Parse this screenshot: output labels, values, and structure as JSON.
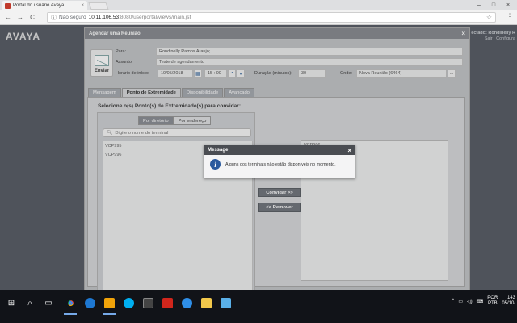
{
  "browser": {
    "tab_title": "Portal do usuário Avaya",
    "tab_close": "×",
    "win_min": "–",
    "win_max": "□",
    "win_close": "×",
    "back": "←",
    "forward": "→",
    "reload": "C",
    "security_label": "Não seguro",
    "url_host": "10.11.106.53",
    "url_rest": ":8080/userportal/views/main.jsf",
    "star": "☆",
    "menu": "⋮"
  },
  "portal": {
    "brand": "AVAYA",
    "user_name": "ectado: Rondinelly R",
    "links": [
      "Sair",
      "Configura"
    ]
  },
  "dialog": {
    "title": "Agendar uma Reunião",
    "close": "×",
    "send_label": "Enviar",
    "para_label": "Para:",
    "para_value": "Rondinelly Ramos Araujo;",
    "assunto_label": "Assunto:",
    "assunto_value": "Teste de agendamento",
    "horario_label": "Horário de início:",
    "date_value": "10/05/2018",
    "time_value": "15 : 00",
    "duracao_label": "Duração (minutos):",
    "duracao_value": "30",
    "onde_label": "Onde:",
    "onde_value": "Nova Reunião (6464)",
    "onde_btn": "...",
    "tabs": [
      "Mensagem",
      "Ponto de Extremidade",
      "Disponibilidade",
      "Avançado"
    ],
    "instruction": "Selecione o(s) Ponto(s) de Extremidade(s) para convidar:",
    "seg_directory": "Por diretório",
    "seg_address": "Por endereço",
    "search_placeholder": "Digite o nome do terminal",
    "left_items": [
      "VCP995",
      "VCP996"
    ],
    "right_items": [
      "VCP996"
    ],
    "invite_btn": "Convidar >>",
    "remove_btn": "<< Remover"
  },
  "message": {
    "title": "Message",
    "close": "×",
    "icon": "i",
    "text": "Alguns dos terminais não estão disponíveis no momento."
  },
  "taskbar": {
    "start": "⊞",
    "search": "⌕",
    "taskview": "▭",
    "lang_top": "POR",
    "lang_bottom": "PTB",
    "time": "143",
    "date": "05/10/"
  },
  "colors": {
    "taskbar": "#111318",
    "dialog_header": "#8a8d92",
    "modal_header": "#4a4d52",
    "info_icon": "#2a5a9e"
  }
}
